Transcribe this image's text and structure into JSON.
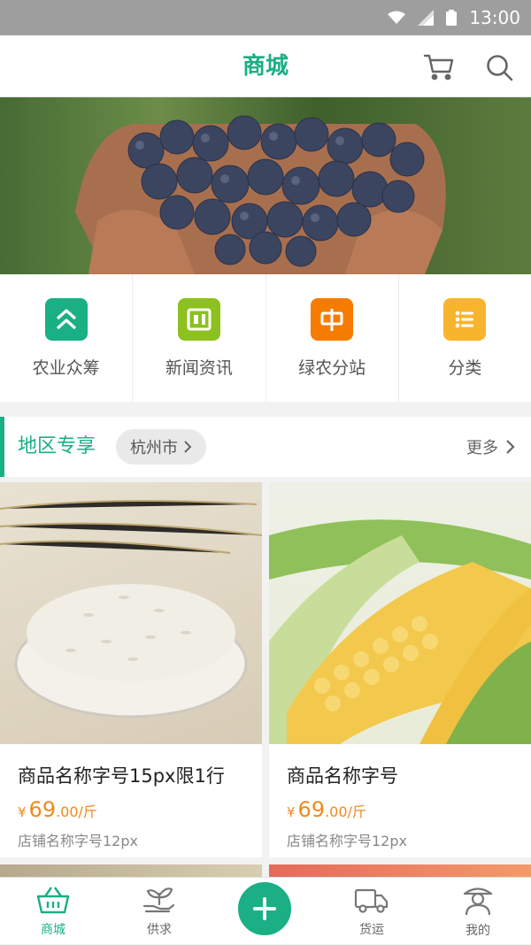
{
  "status_bar": {
    "time": "13:00"
  },
  "header": {
    "title": "商城"
  },
  "quick_entries": [
    {
      "label": "农业众筹",
      "icon": "crowdfunding-icon",
      "color": "#1aaf85"
    },
    {
      "label": "新闻资讯",
      "icon": "news-icon",
      "color": "#8cc11f"
    },
    {
      "label": "绿农分站",
      "icon": "substation-icon",
      "color": "#f57c00"
    },
    {
      "label": "分类",
      "icon": "category-icon",
      "color": "#f9b42d"
    }
  ],
  "region": {
    "title": "地区专享",
    "city": "杭州市",
    "more": "更多"
  },
  "products": [
    {
      "name": "商品名称字号15px限1行",
      "currency": "¥",
      "price_int": "69",
      "price_dec": ".00/斤",
      "shop": "店铺名称字号12px"
    },
    {
      "name": "商品名称字号",
      "currency": "¥",
      "price_int": "69",
      "price_dec": ".00/斤",
      "shop": "店铺名称字号12px"
    }
  ],
  "tabbar": {
    "tabs": [
      {
        "label": "商城",
        "icon": "basket-icon",
        "active": true
      },
      {
        "label": "供求",
        "icon": "plant-hand-icon",
        "active": false
      },
      {
        "label": "货运",
        "icon": "truck-icon",
        "active": false
      },
      {
        "label": "我的",
        "icon": "farmer-icon",
        "active": false
      }
    ],
    "fab_icon": "plus-icon"
  },
  "colors": {
    "brand": "#1aaf85",
    "price": "#f08a1c"
  }
}
